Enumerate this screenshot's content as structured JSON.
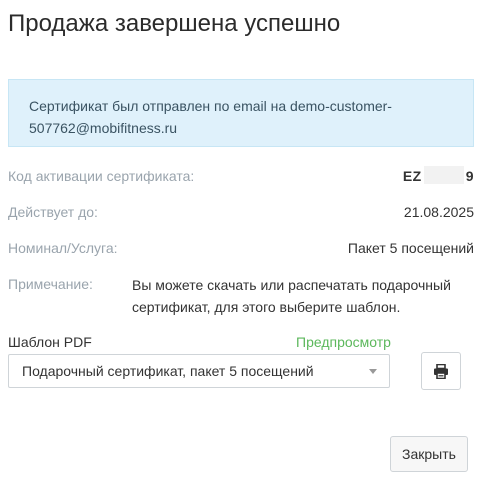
{
  "dialog": {
    "title": "Продажа завершена успешно",
    "alert_line1": "Сертификат был отправлен по email на demo-customer-",
    "alert_line2": "507762@mobifitness.ru"
  },
  "details": {
    "activation_code_label": "Код активации сертификата:",
    "activation_code_start": "EZ",
    "activation_code_end": "9",
    "valid_until_label": "Действует до:",
    "valid_until_value": "21.08.2025",
    "nominal_label": "Номинал/Услуга:",
    "nominal_value": "Пакет 5 посещений",
    "note_label": "Примечание:",
    "note_line1": "Вы можете скачать или распечатать подарочный",
    "note_line2": "сертификат, для этого выберите шаблон."
  },
  "pdf": {
    "label": "Шаблон PDF",
    "preview_link": "Предпросмотр",
    "selected_template": "Подарочный сертификат, пакет 5 посещений",
    "print_icon": "print-icon"
  },
  "footer": {
    "close_label": "Закрыть"
  }
}
